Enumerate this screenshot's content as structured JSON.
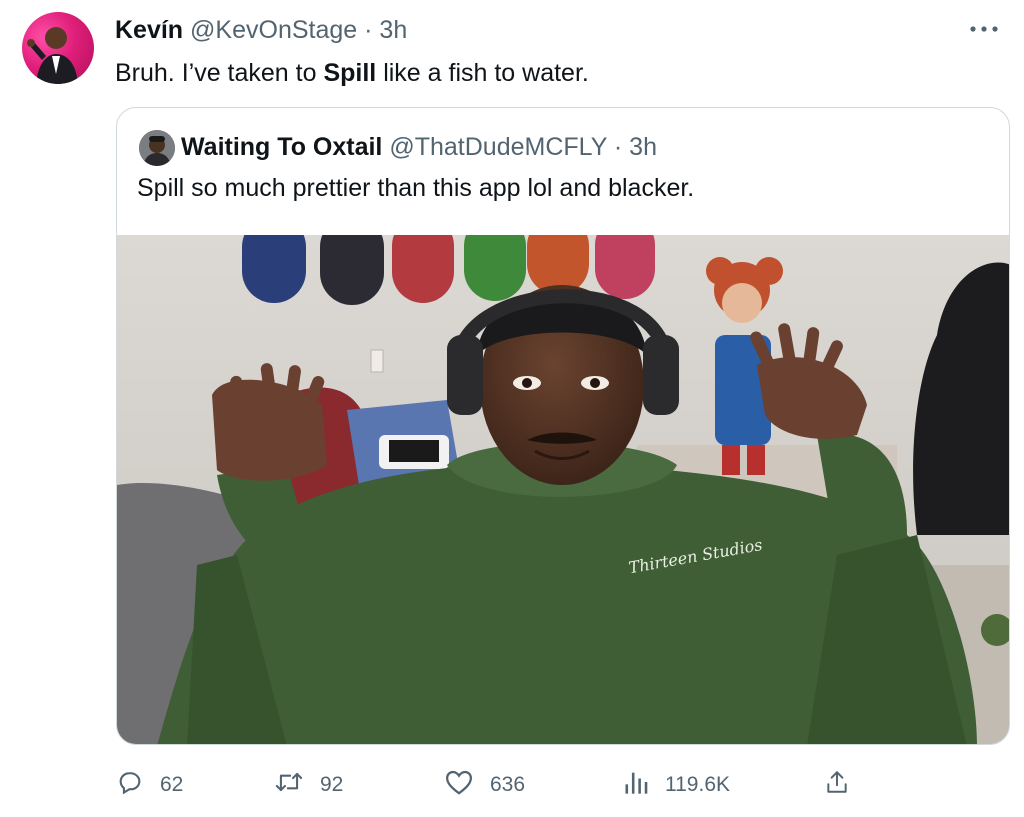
{
  "tweet": {
    "author_name": "Kevín",
    "author_handle": "@KevOnStage",
    "separator": "·",
    "time": "3h",
    "text_before": "Bruh. I’ve taken to ",
    "text_bold": "Spill",
    "text_after": " like a fish to water."
  },
  "quoted": {
    "author_name": "Waiting To Oxtail",
    "author_handle": "@ThatDudeMCFLY",
    "separator": "·",
    "time": "3h",
    "text": "Spill so much prettier than this app lol and blacker.",
    "image_hoodie_script": "Thirteen Studios"
  },
  "actions": {
    "replies": "62",
    "retweets": "92",
    "likes": "636",
    "views": "119.6K"
  },
  "icons": {
    "more": "more-horizontal-icon",
    "reply": "reply-icon",
    "retweet": "retweet-icon",
    "like": "heart-icon",
    "views": "bar-chart-icon",
    "share": "share-icon"
  },
  "colors": {
    "text": "#0f1419",
    "secondary": "#536471",
    "border": "#cfd9de",
    "avatar_bg": "#e01f7a"
  }
}
